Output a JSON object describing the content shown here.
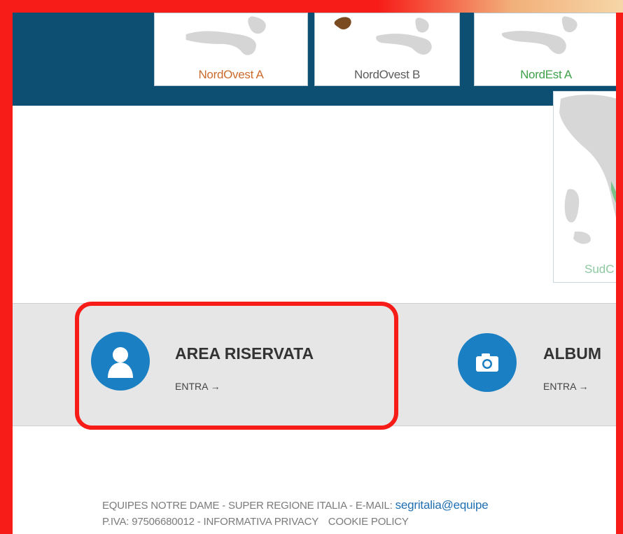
{
  "regions": [
    {
      "label": "NordOvest A",
      "color": "#cc6b2e"
    },
    {
      "label": "NordOvest B",
      "color": "#5c5c5c"
    },
    {
      "label": "NordEst A",
      "color": "#3fa14a"
    }
  ],
  "partial_region": {
    "label": "SudC"
  },
  "features": [
    {
      "title": "AREA RISERVATA",
      "link": "ENTRA →",
      "icon": "person-icon"
    },
    {
      "title": "ALBUM",
      "link": "ENTRA →",
      "icon": "camera-icon"
    }
  ],
  "footer": {
    "line1_prefix": "EQUIPES NOTRE DAME - SUPER REGIONE ITALIA - E-MAIL:",
    "email": "segritalia@equipe",
    "line2_prefix": "P.IVA: 97506680012 - INFORMATIVA PRIVACY",
    "cookie": "COOKIE POLICY"
  },
  "colors": {
    "banner": "#0c4f72",
    "accent_blue": "#1a80c3",
    "highlight_red": "#f71c18"
  }
}
